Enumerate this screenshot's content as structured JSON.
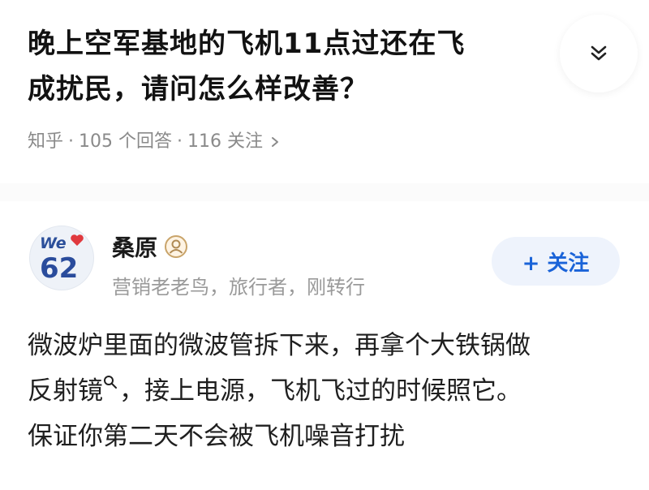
{
  "question": {
    "title_line1": "晚上空军基地的飞机11点过还在飞",
    "title_line2": "成扰民，请问怎么样改善？",
    "source": "知乎",
    "answer_count": "105 个回答",
    "follow_count": "116 关注",
    "separator": "·"
  },
  "answer": {
    "author": {
      "name": "桑原",
      "bio": "营销老老鸟，旅行者，刚转行",
      "avatar_text_top": "We",
      "avatar_number": "62"
    },
    "follow_button": "+ 关注",
    "content": {
      "part1": "微波炉里面的微波管拆下来，再拿个大铁锅做",
      "link": "反射镜",
      "part2": "，接上电源，飞机飞过的时候照它。",
      "part3": "保证你第二天不会被飞机噪音打扰"
    }
  },
  "icons": {
    "expand": "double-chevron-down-icon",
    "meta_chevron": "chevron-right-icon",
    "badge": "user-badge-icon",
    "search": "search-icon"
  },
  "colors": {
    "accent_blue": "#1a63d8",
    "follow_bg": "#eef3fc",
    "meta_gray": "#8a8a8a"
  }
}
